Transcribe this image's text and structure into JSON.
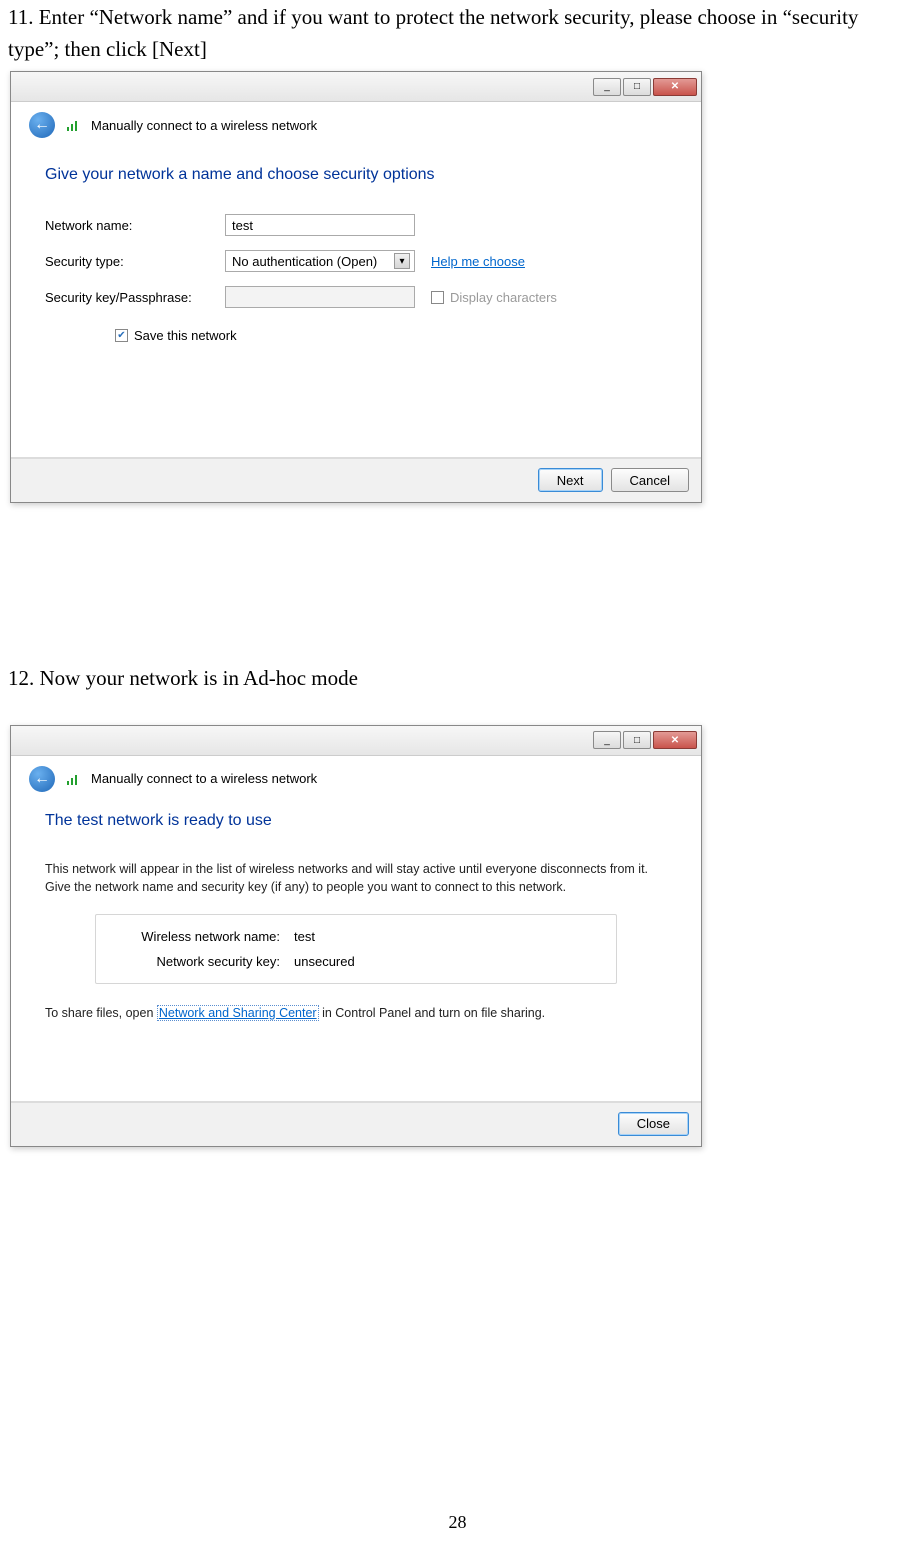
{
  "page_number": "28",
  "step11_text": "11. Enter “Network name” and if you want to protect the network security, please choose in “security type”; then click [Next]",
  "step12_text": "12. Now your network is in Ad-hoc mode",
  "dialog1": {
    "window_title": "Manually connect to a wireless network",
    "heading": "Give your network a name and choose security options",
    "network_name_label": "Network name:",
    "network_name_value": "test",
    "security_type_label": "Security type:",
    "security_type_value": "No authentication (Open)",
    "help_link": "Help me choose",
    "passphrase_label": "Security key/Passphrase:",
    "display_chars_label": "Display characters",
    "save_label": "Save this network",
    "next_btn": "Next",
    "cancel_btn": "Cancel"
  },
  "dialog2": {
    "window_title": "Manually connect to a wireless network",
    "heading": "The test network is ready to use",
    "body": "This network will appear in the list of wireless networks and will stay active until everyone disconnects from it. Give the network name and security key (if any) to people you want to connect to this network.",
    "wname_label": "Wireless network name:",
    "wname_value": "test",
    "key_label": "Network security key:",
    "key_value": "unsecured",
    "share_prefix": "To share files, open ",
    "share_link": "Network and Sharing Center",
    "share_suffix": " in Control Panel and turn on file sharing.",
    "close_btn": "Close"
  }
}
